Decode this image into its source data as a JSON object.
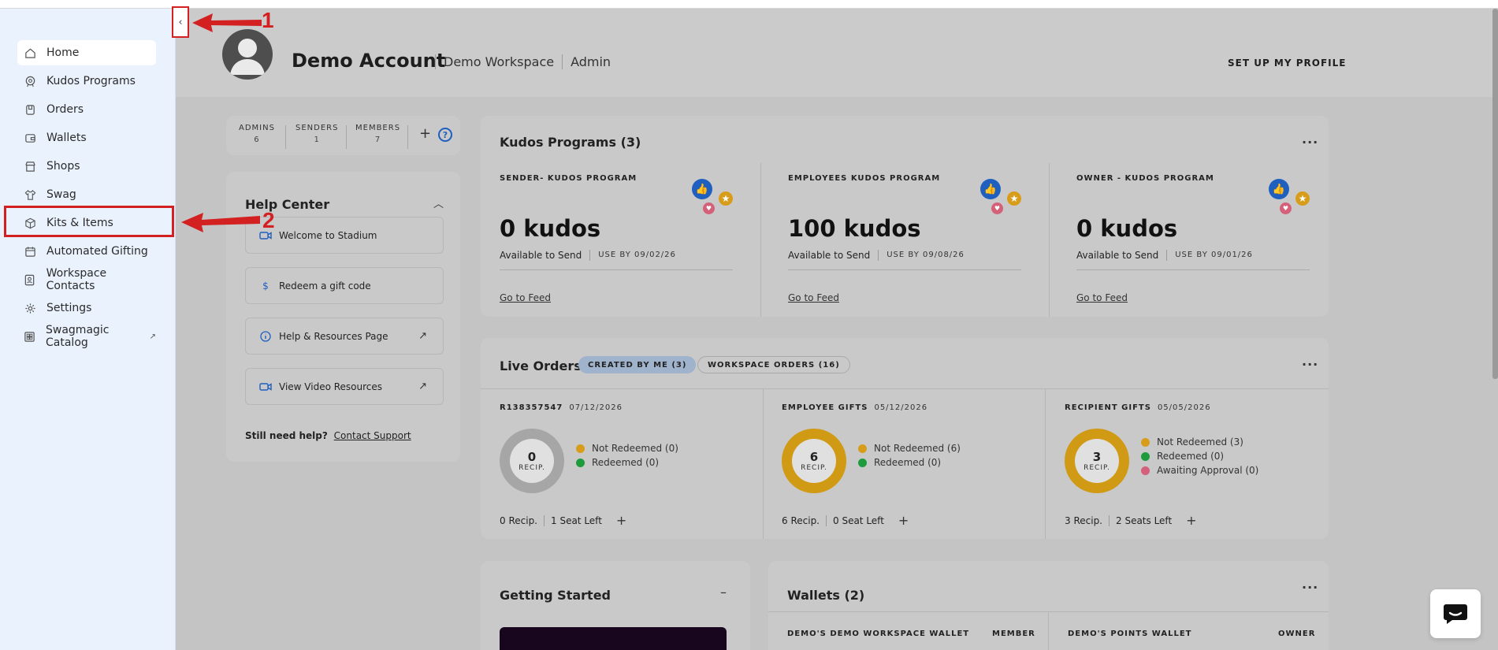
{
  "nav": {
    "items": [
      {
        "label": "Home",
        "icon": "home-icon"
      },
      {
        "label": "Kudos Programs",
        "icon": "kudos-icon"
      },
      {
        "label": "Orders",
        "icon": "orders-icon"
      },
      {
        "label": "Wallets",
        "icon": "wallet-icon"
      },
      {
        "label": "Shops",
        "icon": "shop-icon"
      },
      {
        "label": "Swag",
        "icon": "shirt-icon"
      },
      {
        "label": "Kits & Items",
        "icon": "box-icon"
      },
      {
        "label": "Automated Gifting",
        "icon": "calendar-icon"
      },
      {
        "label": "Workspace Contacts",
        "icon": "contacts-icon"
      },
      {
        "label": "Settings",
        "icon": "gear-icon"
      },
      {
        "label": "Swagmagic Catalog",
        "icon": "catalog-icon"
      }
    ],
    "collapse_glyph": "‹",
    "external_glyph": "↗"
  },
  "annotations": {
    "one": "1",
    "two": "2"
  },
  "header": {
    "account_name": "Demo Account",
    "workspace": "Demo Workspace",
    "role": "Admin",
    "setup_profile": "SET UP MY PROFILE"
  },
  "roles": {
    "admins_label": "ADMINS",
    "admins_count": "6",
    "senders_label": "SENDERS",
    "senders_count": "1",
    "members_label": "MEMBERS",
    "members_count": "7",
    "add_glyph": "+",
    "help_glyph": "?"
  },
  "help_center": {
    "title": "Help Center",
    "chevron": "︿",
    "items": [
      {
        "label": "Welcome to Stadium",
        "icon": "video-icon"
      },
      {
        "label": "Redeem a gift code",
        "icon": "dollar-icon"
      },
      {
        "label": "Help & Resources Page",
        "icon": "info-icon"
      },
      {
        "label": "View Video Resources",
        "icon": "video-icon"
      }
    ],
    "open_glyph": "↗",
    "still_need": "Still need help?",
    "contact": "Contact Support"
  },
  "kudos": {
    "title": "Kudos Programs (3)",
    "menu": "···",
    "programs": [
      {
        "name": "SENDER- KUDOS PROGRAM",
        "amount": "0 kudos",
        "available": "Available to Send",
        "use_by": "USE BY 09/02/26",
        "link": "Go to Feed"
      },
      {
        "name": "EMPLOYEES KUDOS PROGRAM",
        "amount": "100 kudos",
        "available": "Available to Send",
        "use_by": "USE BY 09/08/26",
        "link": "Go to Feed"
      },
      {
        "name": "OWNER - KUDOS PROGRAM",
        "amount": "0 kudos",
        "available": "Available to Send",
        "use_by": "USE BY 09/01/26",
        "link": "Go to Feed"
      }
    ]
  },
  "orders": {
    "title": "Live Orders",
    "tab_mine": "CREATED BY ME (3)",
    "tab_workspace": "WORKSPACE ORDERS (16)",
    "menu": "···",
    "recip_label": "RECIP.",
    "add_glyph": "+",
    "cards": [
      {
        "name": "R138357547",
        "date": "07/12/2026",
        "count": "0",
        "color": "#a6a6a6",
        "legend": [
          {
            "label": "Not Redeemed (0)",
            "color": "#d79d1a"
          },
          {
            "label": "Redeemed (0)",
            "color": "#1e9b3c"
          }
        ],
        "recip": "0 Recip.",
        "seats": "1 Seat Left"
      },
      {
        "name": "EMPLOYEE GIFTS",
        "date": "05/12/2026",
        "count": "6",
        "color": "#d09a14",
        "legend": [
          {
            "label": "Not Redeemed (6)",
            "color": "#d79d1a"
          },
          {
            "label": "Redeemed (0)",
            "color": "#1e9b3c"
          }
        ],
        "recip": "6 Recip.",
        "seats": "0 Seat Left"
      },
      {
        "name": "RECIPIENT GIFTS",
        "date": "05/05/2026",
        "count": "3",
        "color": "#d09a14",
        "legend": [
          {
            "label": "Not Redeemed (3)",
            "color": "#d79d1a"
          },
          {
            "label": "Redeemed (0)",
            "color": "#1e9b3c"
          },
          {
            "label": "Awaiting Approval (0)",
            "color": "#d4607a"
          }
        ],
        "recip": "3 Recip.",
        "seats": "2 Seats Left"
      }
    ]
  },
  "getting_started": {
    "title": "Getting Started",
    "minimize": "–"
  },
  "wallets": {
    "title": "Wallets (2)",
    "menu": "···",
    "left_name": "DEMO'S DEMO WORKSPACE WALLET",
    "left_role": "MEMBER",
    "right_name": "DEMO'S POINTS WALLET",
    "right_role": "OWNER"
  }
}
